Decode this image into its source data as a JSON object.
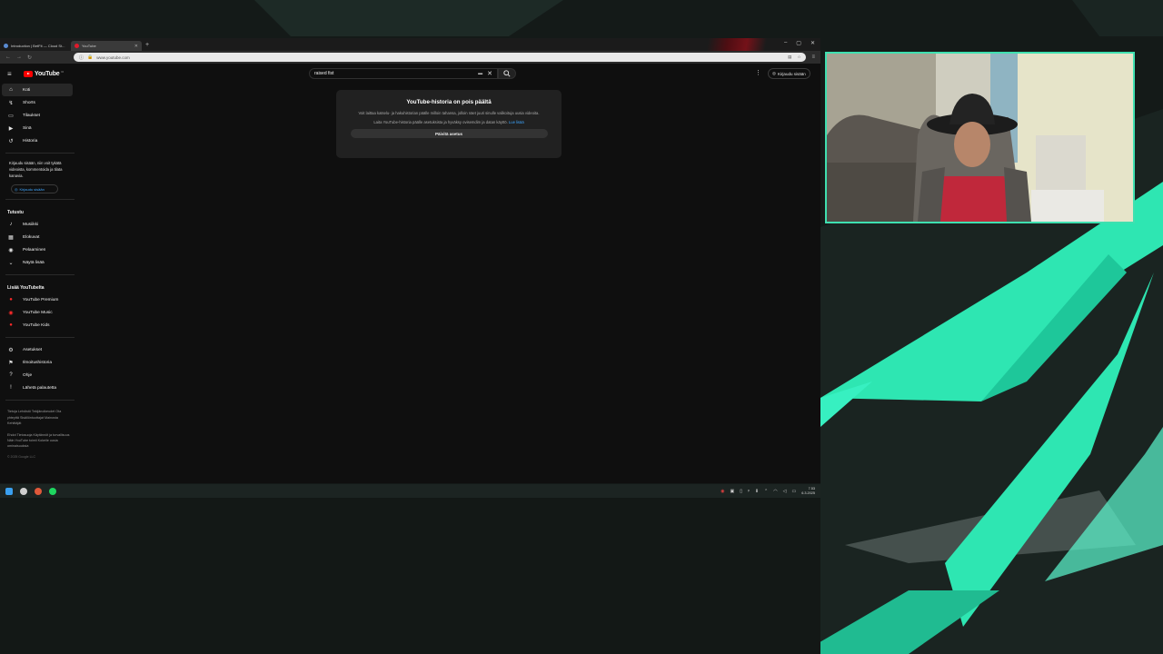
{
  "browser": {
    "tabs": [
      {
        "title": "Introduction | BetFit — Cloud St..."
      },
      {
        "title": "YouTube"
      }
    ],
    "url": "www.youtube.com"
  },
  "youtube": {
    "logo_text": "YouTube",
    "logo_country": "FI",
    "search_value": "raised fist",
    "signin_label": "Kirjaudu sisään",
    "sidebar": {
      "main": [
        {
          "label": "Koti",
          "icon": "home-icon"
        },
        {
          "label": "Shorts",
          "icon": "shorts-icon"
        },
        {
          "label": "Tilaukset",
          "icon": "subscriptions-icon"
        },
        {
          "label": "Sinä",
          "icon": "you-icon"
        },
        {
          "label": "Historia",
          "icon": "history-icon"
        }
      ],
      "promo_text": "Kirjaudu sisään, niin voit tykätä videoista, kommentoida ja tilata kanavia.",
      "promo_button": "Kirjaudu sisään",
      "explore_heading": "Tutustu",
      "explore": [
        {
          "label": "Musiikki",
          "icon": "music-icon"
        },
        {
          "label": "Elokuvat",
          "icon": "movies-icon"
        },
        {
          "label": "Pelaaminen",
          "icon": "gaming-icon"
        },
        {
          "label": "Näytä lisää",
          "icon": "chevron-down-icon"
        }
      ],
      "more_heading": "Lisää YouTubelta",
      "more": [
        {
          "label": "YouTube Premium"
        },
        {
          "label": "YouTube Music"
        },
        {
          "label": "YouTube Kids"
        }
      ],
      "settings": [
        {
          "label": "Asetukset",
          "icon": "gear-icon"
        },
        {
          "label": "Ilmoitushistoria",
          "icon": "flag-icon"
        },
        {
          "label": "Ohje",
          "icon": "help-icon"
        },
        {
          "label": "Lähetä palautetta",
          "icon": "feedback-icon"
        }
      ],
      "footer1": "Tietoja Lehdistö Tekijänoikeudet Ota yhteyttä Sisällöntuottajat Mainosta Kehittäjät",
      "footer2": "Ehdot Tietosuoja Käytännöt ja turvallisuus Näin YouTube toimii Kokeile uusia ominaisuuksia",
      "copyright": "© 2025 Google LLC"
    },
    "history_card": {
      "title": "YouTube-historia on pois päältä",
      "body": "Voit laittaa katselu- ja hakuhistorian päälle milloin tahansa, jolloin näet juuri sinulle valikoituja uusia videoita.",
      "body2": "Laita YouTube-historia päälle asetuksista ja hyväksy ovisemdim ja datan käyttö.",
      "link": "Lue lisää",
      "button": "Päivitä asetus"
    }
  },
  "taskbar": {
    "time": "7.53",
    "date": "6.3.2025"
  },
  "colors": {
    "accent_teal": "#3fe0b0",
    "yt_red": "#ff0000",
    "link_blue": "#3ea6ff"
  }
}
